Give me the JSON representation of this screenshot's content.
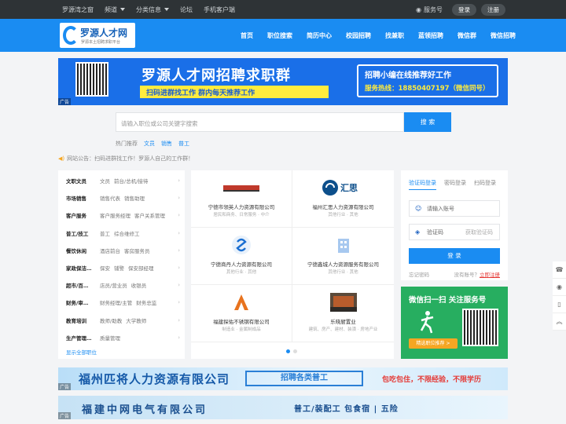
{
  "topbar": {
    "items": [
      "罗源湾之窗",
      "频道",
      "分类信息",
      "论坛",
      "手机客户端"
    ],
    "service": "服务号",
    "login": "登录",
    "register": "注册"
  },
  "logo": {
    "title": "罗源人才网",
    "sub": "罗源本土招聘求职平台"
  },
  "nav": {
    "items": [
      "首页",
      "职位搜索",
      "简历中心",
      "校园招聘",
      "找兼职",
      "蓝领招聘",
      "微信群",
      "微信招聘"
    ]
  },
  "banner": {
    "title": "罗源人才网招聘求职群",
    "sub": "扫码进群找工作  群内每天推荐工作",
    "box1": "招聘小编在线推荐好工作",
    "box2": "服务热线：18850407197（微信同号）",
    "ad": "广告"
  },
  "search": {
    "placeholder": "请输入职位或公司关键字搜索",
    "button": "搜 索",
    "hot_label": "热门推荐",
    "hot": [
      "文员",
      "销售",
      "普工"
    ]
  },
  "notice": "网站公告：扫码进群找工作！罗源人自己的工作群！",
  "categories": [
    {
      "h": "文职文员",
      "s": [
        "文员",
        "前台/总机/接待"
      ]
    },
    {
      "h": "市场销售",
      "s": [
        "销售代表",
        "销售助理"
      ]
    },
    {
      "h": "客户服务",
      "s": [
        "客户服务经理",
        "客户关系管理"
      ]
    },
    {
      "h": "普工/技工",
      "s": [
        "普工",
        "综合维修工"
      ]
    },
    {
      "h": "餐饮休闲",
      "s": [
        "酒店前台",
        "客房服务员"
      ]
    },
    {
      "h": "家政保洁…",
      "s": [
        "保安",
        "铺警",
        "保安部经理"
      ]
    },
    {
      "h": "超市/百…",
      "s": [
        "店员/营业员",
        "收银员"
      ]
    },
    {
      "h": "财务/审…",
      "s": [
        "财务经理/主管",
        "财务总监"
      ]
    },
    {
      "h": "教育培训",
      "s": [
        "教师/助教",
        "大学教师"
      ]
    },
    {
      "h": "生产管理…",
      "s": [
        "质量管理"
      ]
    }
  ],
  "cat_all": "显示全部职位",
  "companies": [
    {
      "name": "宁德市领英人力资源有限公司",
      "desc": "居民和商务、日常服务 · 中介",
      "logo": "LY"
    },
    {
      "name": "福州汇思人力资源有限公司",
      "desc": "其他行业 · 其他",
      "logo": "汇思"
    },
    {
      "name": "宁德商丹人力资源有限公司",
      "desc": "其他行业 · 其他",
      "logo": "S"
    },
    {
      "name": "宁德鑫城人力资源服务有限公司",
      "desc": "其他行业 · 其他",
      "logo": "bldg"
    },
    {
      "name": "福建探佑不锈钢有限公司",
      "desc": "制造业 · 金属制成品",
      "logo": "tan"
    },
    {
      "name": "乐晓厨置业",
      "desc": "建筑、房产、建材、装潢 · 房地产业",
      "logo": "photo"
    }
  ],
  "login": {
    "tabs": [
      "验证码登录",
      "密码登录",
      "扫码登录"
    ],
    "phone": "请输入账号",
    "code": "验证码",
    "getcode": "获取验证码",
    "btn": "登 录",
    "forgot": "忘记密码",
    "noacc": "没有账号？",
    "reg": "立即注册"
  },
  "wx": {
    "title": "微信扫一扫 关注服务号",
    "btn": "精选职位推荐 >"
  },
  "ban2": {
    "title": "福州匹将人力资源有限公司",
    "box": "招聘各类普工",
    "right": "包吃包住，不限经验，不限学历",
    "ad": "广告"
  },
  "ban3": {
    "title": "福建中网电气有限公司",
    "right": "普工/装配工   包食宿 | 五险",
    "ad": "广告"
  },
  "colors": {
    "brand": "#1a8cf2",
    "topbar": "#2e3336",
    "wechat": "#27ae60"
  }
}
